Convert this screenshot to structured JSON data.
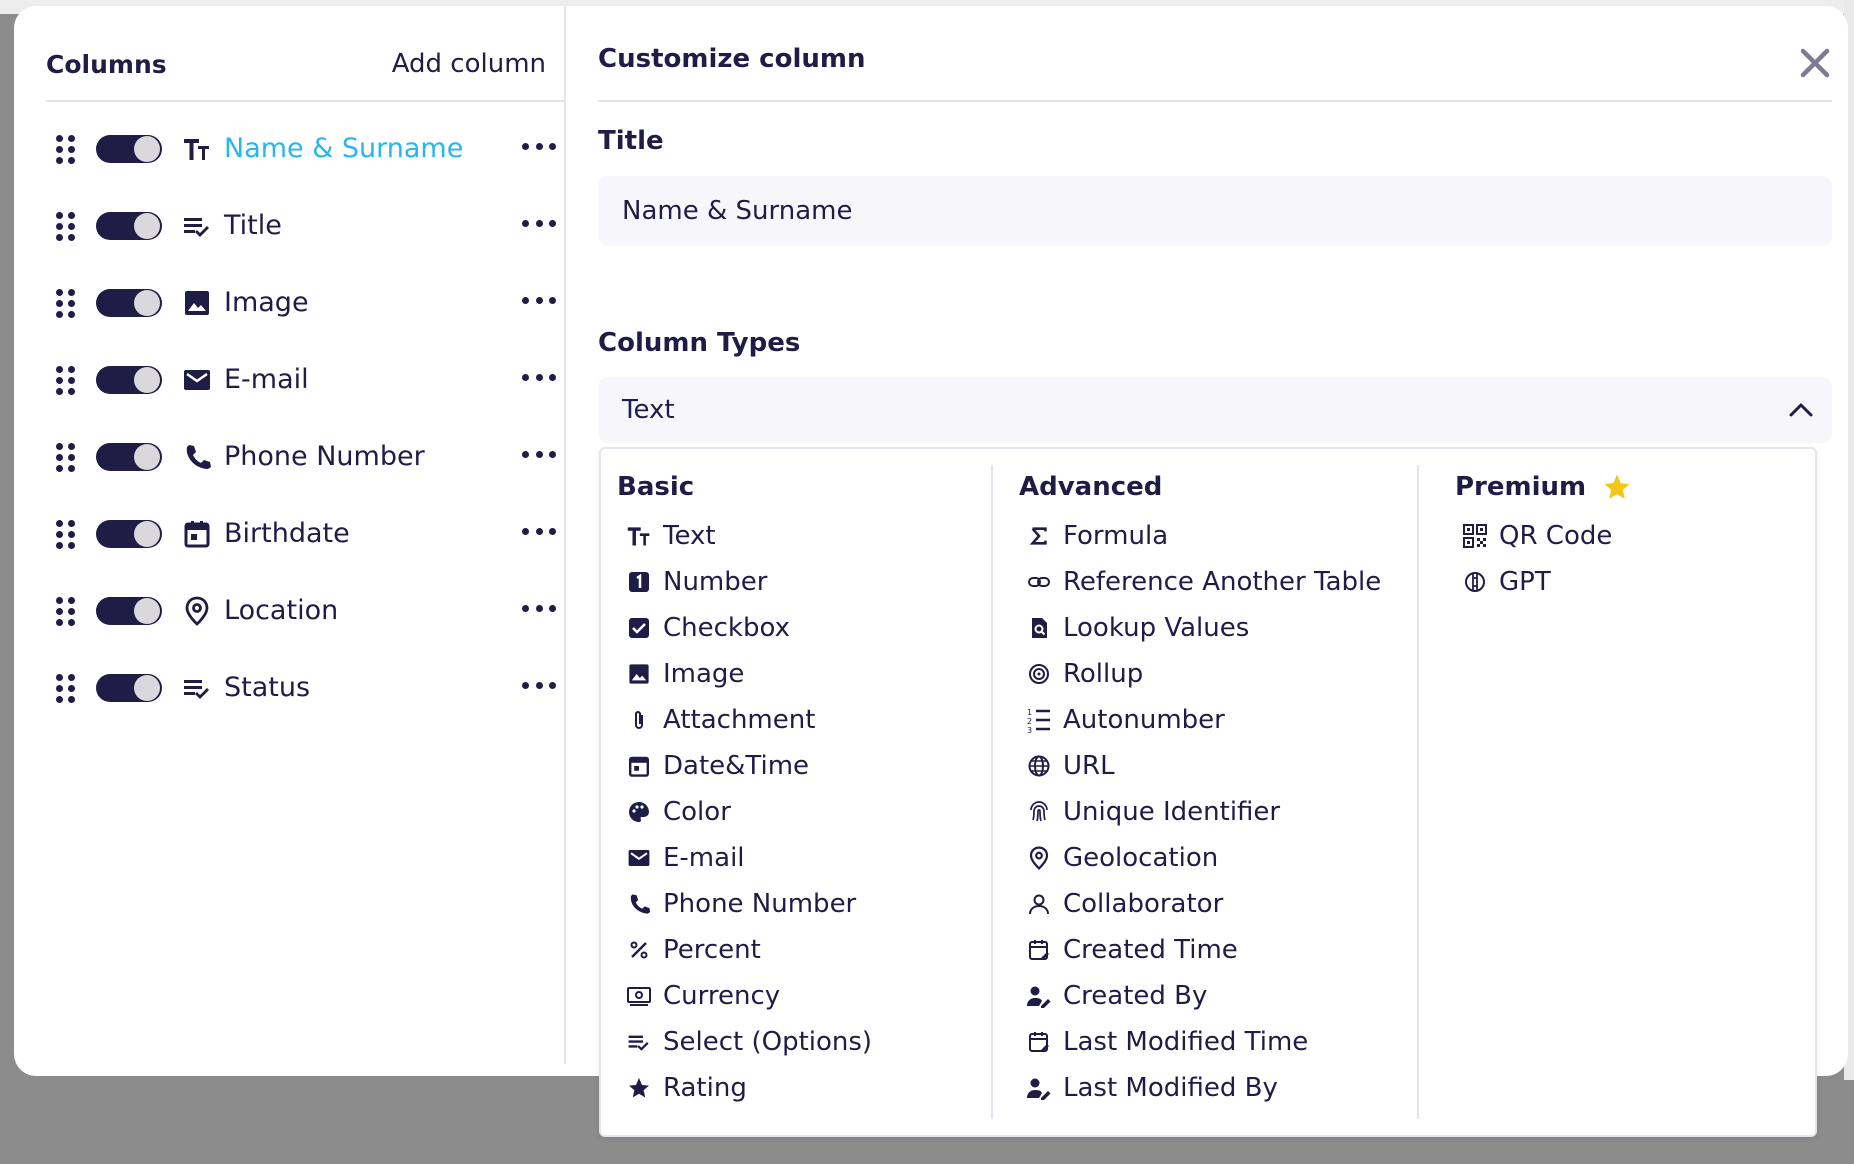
{
  "left_panel": {
    "heading": "Columns",
    "add_label": "Add column",
    "columns": [
      {
        "label": "Name & Surname",
        "icon": "text-format-icon",
        "active": true
      },
      {
        "label": "Title",
        "icon": "list-check-icon"
      },
      {
        "label": "Image",
        "icon": "image-icon"
      },
      {
        "label": "E-mail",
        "icon": "mail-icon"
      },
      {
        "label": "Phone Number",
        "icon": "phone-icon"
      },
      {
        "label": "Birthdate",
        "icon": "calendar-icon"
      },
      {
        "label": "Location",
        "icon": "location-pin-icon"
      },
      {
        "label": "Status",
        "icon": "list-check-icon"
      }
    ]
  },
  "right_panel": {
    "title": "Customize column",
    "title_label": "Title",
    "title_value": "Name & Surname",
    "types_label": "Column Types",
    "selected_type": "Text"
  },
  "dropdown": {
    "basic": {
      "heading": "Basic",
      "items": [
        "Text",
        "Number",
        "Checkbox",
        "Image",
        "Attachment",
        "Date&Time",
        "Color",
        "E-mail",
        "Phone Number",
        "Percent",
        "Currency",
        "Select (Options)",
        "Rating"
      ]
    },
    "advanced": {
      "heading": "Advanced",
      "items": [
        "Formula",
        "Reference Another Table",
        "Lookup Values",
        "Rollup",
        "Autonumber",
        "URL",
        "Unique Identifier",
        "Geolocation",
        "Collaborator",
        "Created Time",
        "Created By",
        "Last Modified Time",
        "Last Modified By"
      ]
    },
    "premium": {
      "heading": "Premium",
      "items": [
        "QR Code",
        "GPT"
      ]
    }
  },
  "colors": {
    "text": "#1f1d46",
    "active": "#29b6f0",
    "star": "#f5c518",
    "field_bg": "#f6f6fb",
    "close": "#7d7a92"
  }
}
